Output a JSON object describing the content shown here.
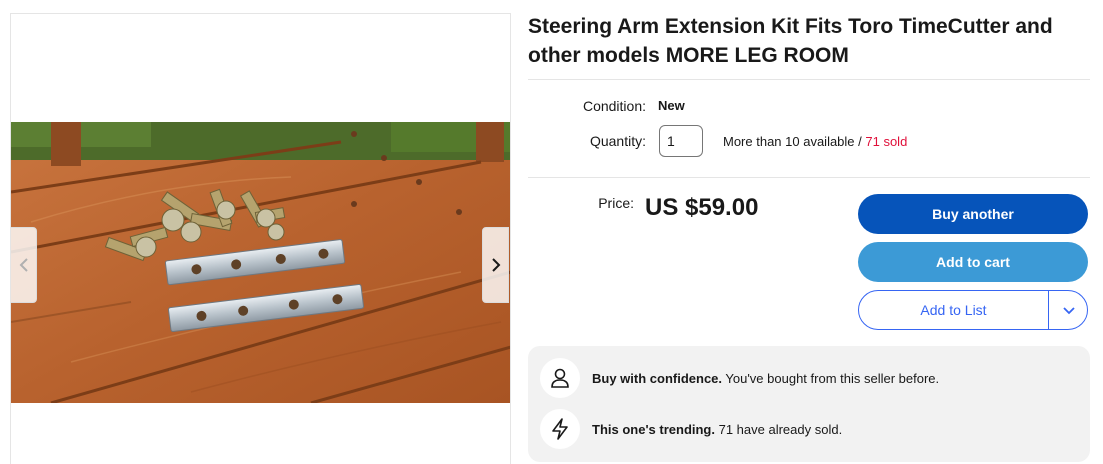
{
  "product": {
    "title": "Steering Arm Extension Kit Fits Toro TimeCutter and other models MORE LEG ROOM"
  },
  "details": {
    "condition_label": "Condition:",
    "condition_value": "New",
    "quantity_label": "Quantity:",
    "quantity_value": "1",
    "availability": "More than 10 available / ",
    "sold": "71 sold"
  },
  "pricing": {
    "price_label": "Price:",
    "price_value": "US $59.00"
  },
  "actions": {
    "buy_label": "Buy another",
    "cart_label": "Add to cart",
    "list_label": "Add to List"
  },
  "perks": [
    {
      "icon": "person-icon",
      "title": "Buy with confidence.",
      "text": " You've bought from this seller before."
    },
    {
      "icon": "lightning-icon",
      "title": "This one's trending.",
      "text": " 71 have already sold."
    }
  ],
  "gallery": {
    "prev_icon": "chevron-left-icon",
    "next_icon": "chevron-right-icon"
  },
  "colors": {
    "primary_button": "#0654ba",
    "secondary_button": "#3c9ad6",
    "link_blue": "#3665f3",
    "sold_red": "#e0103a",
    "panel_bg": "#f2f2f2"
  }
}
